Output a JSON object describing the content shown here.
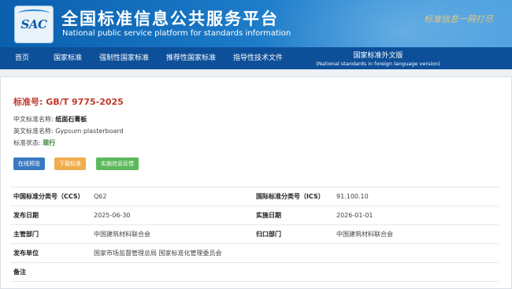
{
  "header": {
    "logo_text": "SAC",
    "title": "全国标准信息公共服务平台",
    "subtitle": "National public service platform  for standards information",
    "slogan": "标准信息一网打尽"
  },
  "nav": {
    "items": [
      "首页",
      "国家标准",
      "强制性国家标准",
      "推荐性国家标准",
      "指导性技术文件"
    ],
    "foreign_label": "国家标准外文版",
    "foreign_sub": "(National standards in foreign language version)"
  },
  "standard": {
    "number_label": "标准号:",
    "number": "GB/T 9775-2025",
    "cn_name_label": "中文标准名称:",
    "cn_name": "纸面石膏板",
    "en_name_label": "英文标准名称:",
    "en_name": "Gypsum plasterboard",
    "status_label": "标准状态:",
    "status": "现行"
  },
  "actions": {
    "preview": "在线预览",
    "download": "下载标准",
    "feedback": "实施信息反馈"
  },
  "details": [
    {
      "l1": "中国标准分类号（CCS）",
      "v1": "Q62",
      "l2": "国际标准分类号（ICS）",
      "v2": "91.100.10"
    },
    {
      "l1": "发布日期",
      "v1": "2025-06-30",
      "l2": "实施日期",
      "v2": "2026-01-01"
    },
    {
      "l1": "主管部门",
      "v1": "中国建筑材料联合会",
      "l2": "归口部门",
      "v2": "中国建筑材料联合会"
    },
    {
      "l1": "发布单位",
      "v1": "国家市场监督管理总局 国家标准化管理委员会",
      "l2": "",
      "v2": ""
    },
    {
      "l1": "备注",
      "v1": "",
      "l2": "",
      "v2": ""
    }
  ],
  "colors": {
    "header_blue": "#1a78c6",
    "nav_blue": "#0d4f99",
    "std_number_red": "#c0392b",
    "status_green": "#2a7a2a",
    "btn_preview": "#3a79c2",
    "btn_download": "#f0ad4e",
    "btn_feedback": "#5cb85c"
  }
}
